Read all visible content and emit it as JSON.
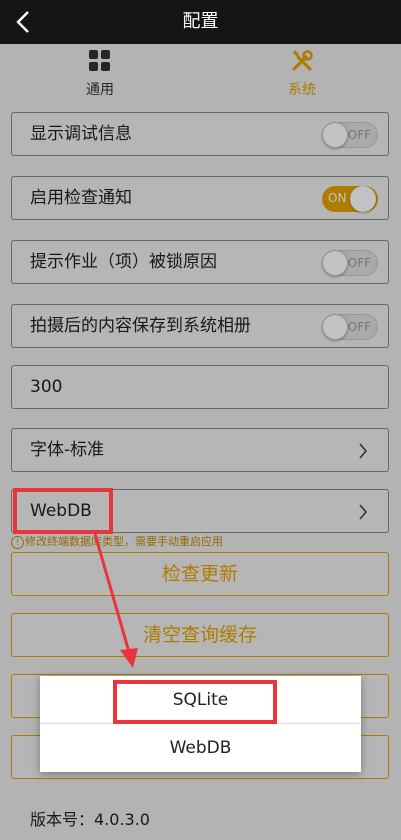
{
  "header": {
    "title": "配置",
    "back_icon": "chevron-left-icon"
  },
  "tabs": [
    {
      "label": "通用",
      "icon": "grid-icon",
      "active": false
    },
    {
      "label": "系统",
      "icon": "tools-icon",
      "active": true
    }
  ],
  "settings": {
    "debug": {
      "label": "显示调试信息",
      "toggle": "OFF"
    },
    "check_notify": {
      "label": "启用检查通知",
      "toggle": "ON"
    },
    "lock_reason": {
      "label": "提示作业（项）被锁原因",
      "toggle": "OFF"
    },
    "save_album": {
      "label": "拍摄后的内容保存到系统相册",
      "toggle": "OFF"
    },
    "number_value": "300",
    "font": "字体-标准",
    "database": "WebDB",
    "database_hint": "修改终端数据库类型，需要手动重启应用",
    "hint_icon": "!"
  },
  "buttons": {
    "check_update": "检查更新",
    "clear_cache": "清空查询缓存"
  },
  "version": "版本号：4.0.3.0",
  "dialog": {
    "options": [
      "SQLite",
      "WebDB"
    ]
  },
  "colors": {
    "accent": "#e4a300",
    "annotation": "#e8353c",
    "titlebar": "#151515"
  }
}
